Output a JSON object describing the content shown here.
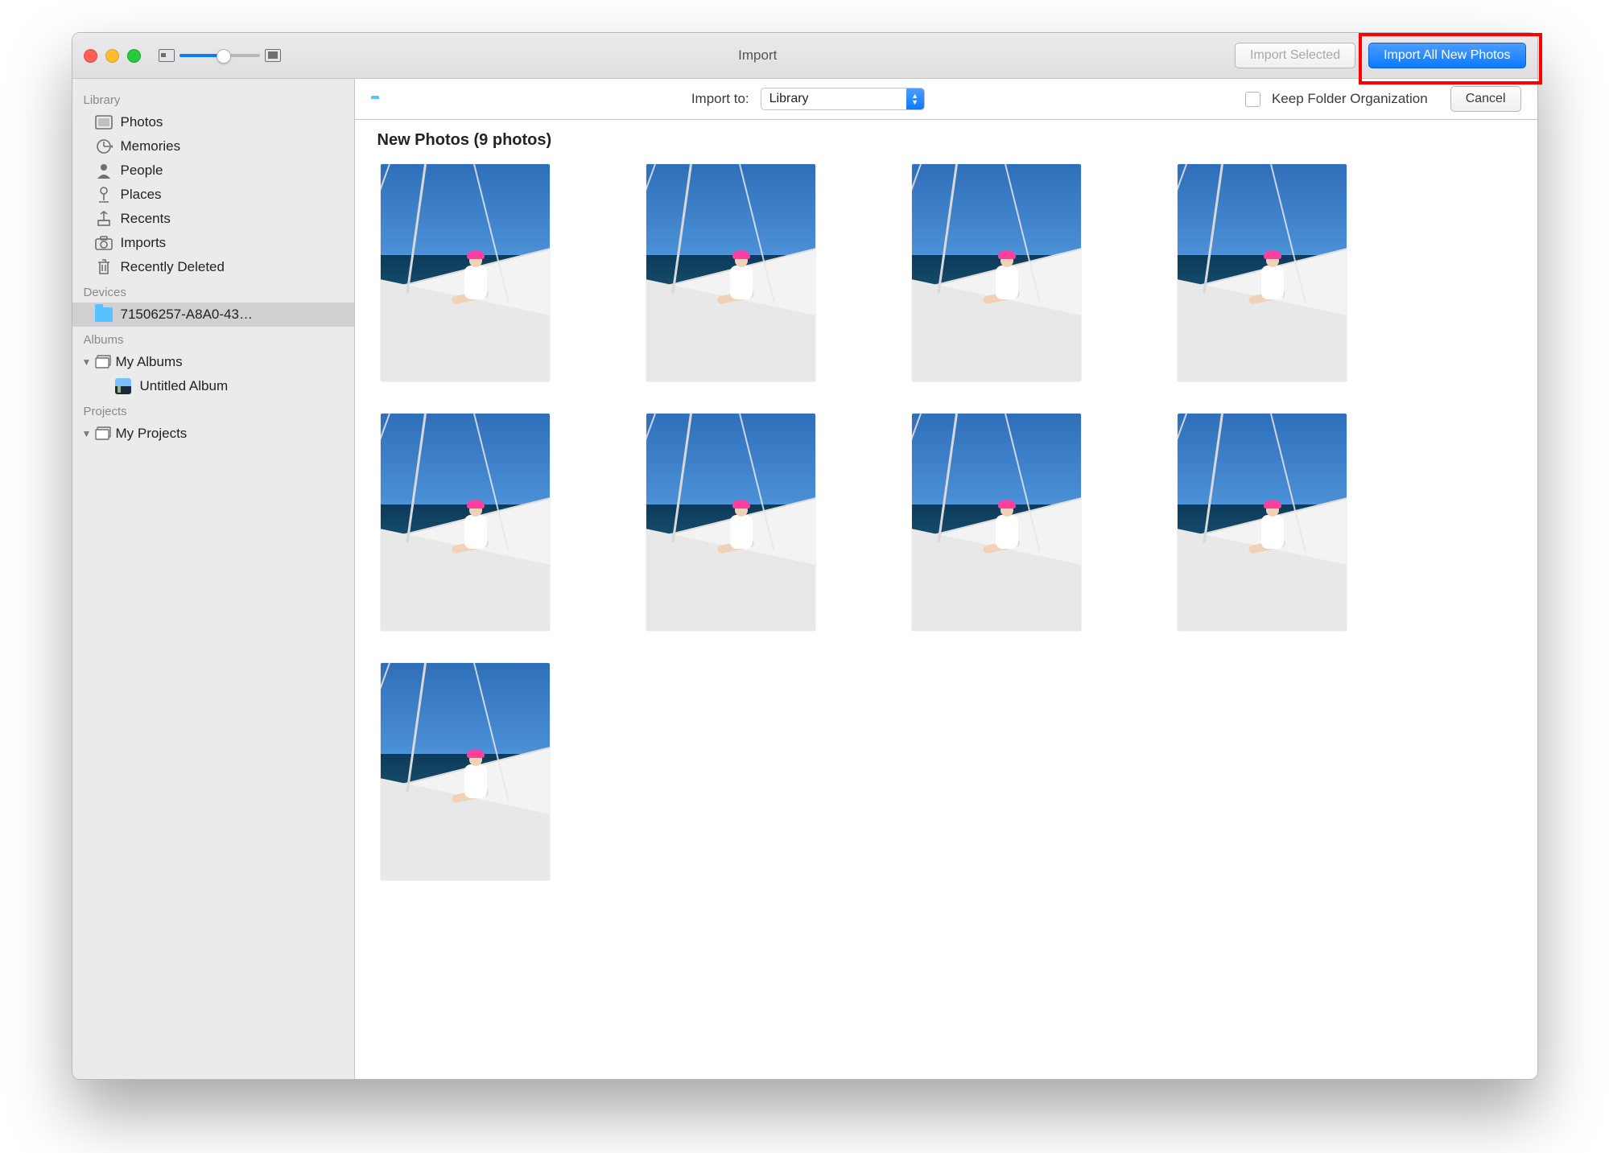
{
  "window": {
    "title": "Import"
  },
  "toolbar": {
    "zoom_slider_percent": 55,
    "import_selected_label": "Import Selected",
    "import_all_label": "Import All New Photos"
  },
  "optbar": {
    "import_to_label": "Import to:",
    "import_to_value": "Library",
    "keep_folder_label": "Keep Folder Organization",
    "keep_folder_checked": false,
    "cancel_label": "Cancel"
  },
  "sidebar": {
    "sections": {
      "library": {
        "header": "Library",
        "items": [
          {
            "id": "photos",
            "label": "Photos",
            "icon": "photos-icon"
          },
          {
            "id": "memories",
            "label": "Memories",
            "icon": "memories-icon"
          },
          {
            "id": "people",
            "label": "People",
            "icon": "people-icon"
          },
          {
            "id": "places",
            "label": "Places",
            "icon": "places-icon"
          },
          {
            "id": "recents",
            "label": "Recents",
            "icon": "recents-icon"
          },
          {
            "id": "imports",
            "label": "Imports",
            "icon": "imports-icon"
          },
          {
            "id": "recently-deleted",
            "label": "Recently Deleted",
            "icon": "trash-icon"
          }
        ]
      },
      "devices": {
        "header": "Devices",
        "items": [
          {
            "id": "device-folder",
            "label": "71506257-A8A0-43…",
            "icon": "folder-icon",
            "selected": true
          }
        ]
      },
      "albums": {
        "header": "Albums",
        "items": [
          {
            "id": "my-albums",
            "label": "My Albums",
            "icon": "album-stack-icon",
            "expanded": true,
            "children": [
              {
                "id": "untitled-album",
                "label": "Untitled Album",
                "icon": "album-thumb-icon"
              }
            ]
          }
        ]
      },
      "projects": {
        "header": "Projects",
        "items": [
          {
            "id": "my-projects",
            "label": "My Projects",
            "icon": "album-stack-icon",
            "expanded": true
          }
        ]
      }
    }
  },
  "content": {
    "section_title": "New Photos (9 photos)",
    "photo_count": 9
  },
  "annotation": {
    "highlight_button": "import-all"
  }
}
